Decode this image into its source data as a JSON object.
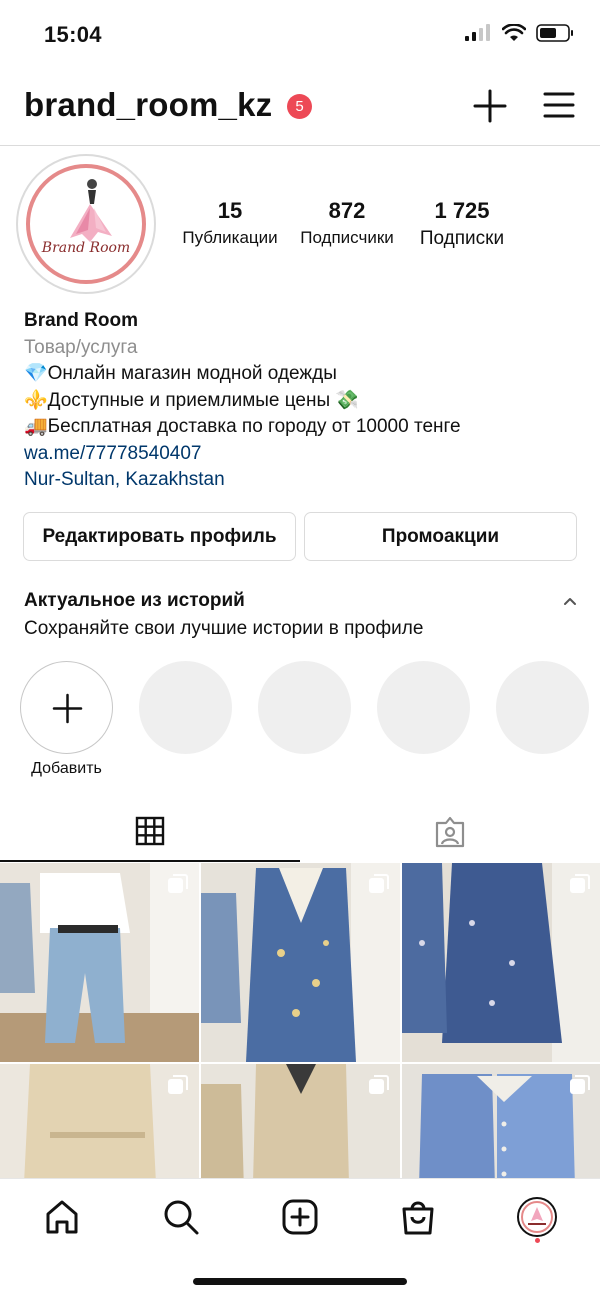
{
  "status_bar": {
    "time": "15:04"
  },
  "header": {
    "username": "brand_room_kz",
    "notification_count": "5"
  },
  "profile": {
    "avatar_logo_text": "Brand Room",
    "stats": [
      {
        "value": "15",
        "label": "Публикации"
      },
      {
        "value": "872",
        "label": "Подписчики"
      },
      {
        "value": "1 725",
        "label": "Подписки"
      }
    ],
    "name": "Brand Room",
    "category": "Товар/услуга",
    "bio_lines": [
      "💎Онлайн магазин модной одежды",
      "⚜️Доступные и приемлимые цены 💸",
      "🚚Бесплатная доставка по городу от 10000 тенге"
    ],
    "link": "wa.me/77778540407",
    "location": "Nur-Sultan, Kazakhstan"
  },
  "actions": {
    "edit_profile": "Редактировать профиль",
    "promotions": "Промоакции"
  },
  "highlights": {
    "title": "Актуальное из историй",
    "subtitle": "Сохраняйте свои лучшие истории в профиле",
    "add_label": "Добавить"
  },
  "tabs": [
    {
      "icon": "grid-icon",
      "active": true
    },
    {
      "icon": "tagged-icon",
      "active": false
    }
  ],
  "posts": [
    {
      "icon": "multi-photo-icon",
      "subject": "white blouse and jeans"
    },
    {
      "icon": "multi-photo-icon",
      "subject": "blue floral dress with white collar"
    },
    {
      "icon": "multi-photo-icon",
      "subject": "blue floral dress"
    },
    {
      "icon": "multi-photo-icon",
      "subject": "beige pleated dress"
    },
    {
      "icon": "multi-photo-icon",
      "subject": "beige wrap suit"
    },
    {
      "icon": "multi-photo-icon",
      "subject": "blue buttoned dresses"
    }
  ],
  "colors": {
    "badge": "#ed4956",
    "link": "#00376b",
    "muted": "#8e8e8e",
    "border": "#dbdbdb"
  },
  "bottom_nav": [
    "home-icon",
    "search-icon",
    "new-post-icon",
    "shop-icon",
    "profile-avatar"
  ]
}
